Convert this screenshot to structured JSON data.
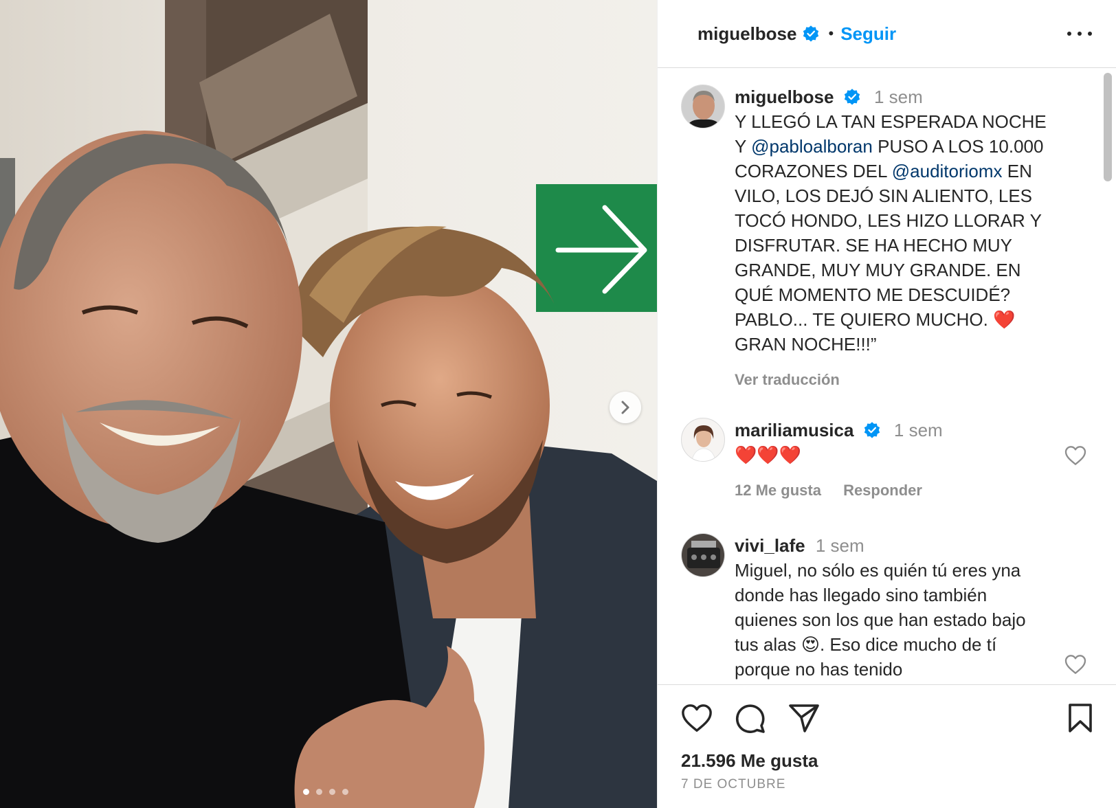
{
  "post": {
    "author": "miguelbose",
    "follow_label": "Seguir",
    "separator": "•",
    "likes_text": "21.596 Me gusta",
    "date_text": "7 DE OCTUBRE",
    "carousel": {
      "slide_count": 4,
      "active_index": 0
    }
  },
  "caption": {
    "user": "miguelbose",
    "time": "1 sem",
    "lines": [
      [
        "Y LLEGÓ LA TAN ESPERADA NOCHE"
      ],
      [
        "Y ",
        "@pabloalboran",
        " PUSO A LOS 10.000"
      ],
      [
        "CORAZONES DEL ",
        "@auditoriomx",
        " EN"
      ],
      [
        "VILO, LOS DEJÓ SIN ALIENTO, LES"
      ],
      [
        "TOCÓ HONDO, LES HIZO LLORAR Y"
      ],
      [
        "DISFRUTAR. SE HA HECHO MUY"
      ],
      [
        "GRANDE, MUY MUY GRANDE. EN"
      ],
      [
        "QUÉ MOMENTO ME DESCUIDÉ?"
      ],
      [
        "PABLO... TE QUIERO MUCHO. ❤️"
      ],
      [
        "GRAN NOCHE!!!”"
      ]
    ],
    "part1": "Y LLEGÓ LA TAN ESPERADA NOCHE Y ",
    "mention1": "@pabloalboran",
    "part2": " PUSO A LOS 10.000 CORAZONES DEL ",
    "mention2": "@auditoriomx",
    "part3": " EN VILO, LOS DEJÓ SIN ALIENTO, LES TOCÓ HONDO, LES HIZO LLORAR Y DISFRUTAR. SE HA HECHO MUY GRANDE, MUY MUY GRANDE. EN QUÉ MOMENTO ME DESCUIDÉ? PABLO... TE QUIERO MUCHO. ❤️ GRAN NOCHE!!!”",
    "translate_label": "Ver traducción"
  },
  "comments": [
    {
      "user": "mariliamusica",
      "verified": true,
      "time": "1 sem",
      "text": "❤️❤️❤️",
      "likes_label": "12 Me gusta",
      "reply_label": "Responder"
    },
    {
      "user": "vivi_lafe",
      "verified": false,
      "time": "1 sem",
      "text_part1": "Miguel, no sólo es quién tú eres yna donde has llegado sino también quienes son los que han estado bajo tus alas ",
      "emoji": "😍",
      "text_part2": ". Eso dice mucho de tí porque no has tenido"
    }
  ],
  "colors": {
    "accent": "#0095f6",
    "mention": "#00376b",
    "muted": "#8e8e8e",
    "text": "#262626",
    "heart": "#ed4956",
    "sign_green": "#1e8a4a"
  },
  "icons": {
    "verified": "verified-badge-icon",
    "more": "more-options-icon",
    "next": "chevron-right-icon",
    "like": "heart-icon",
    "comment": "comment-bubble-icon",
    "share": "paper-plane-icon",
    "save": "bookmark-icon"
  }
}
